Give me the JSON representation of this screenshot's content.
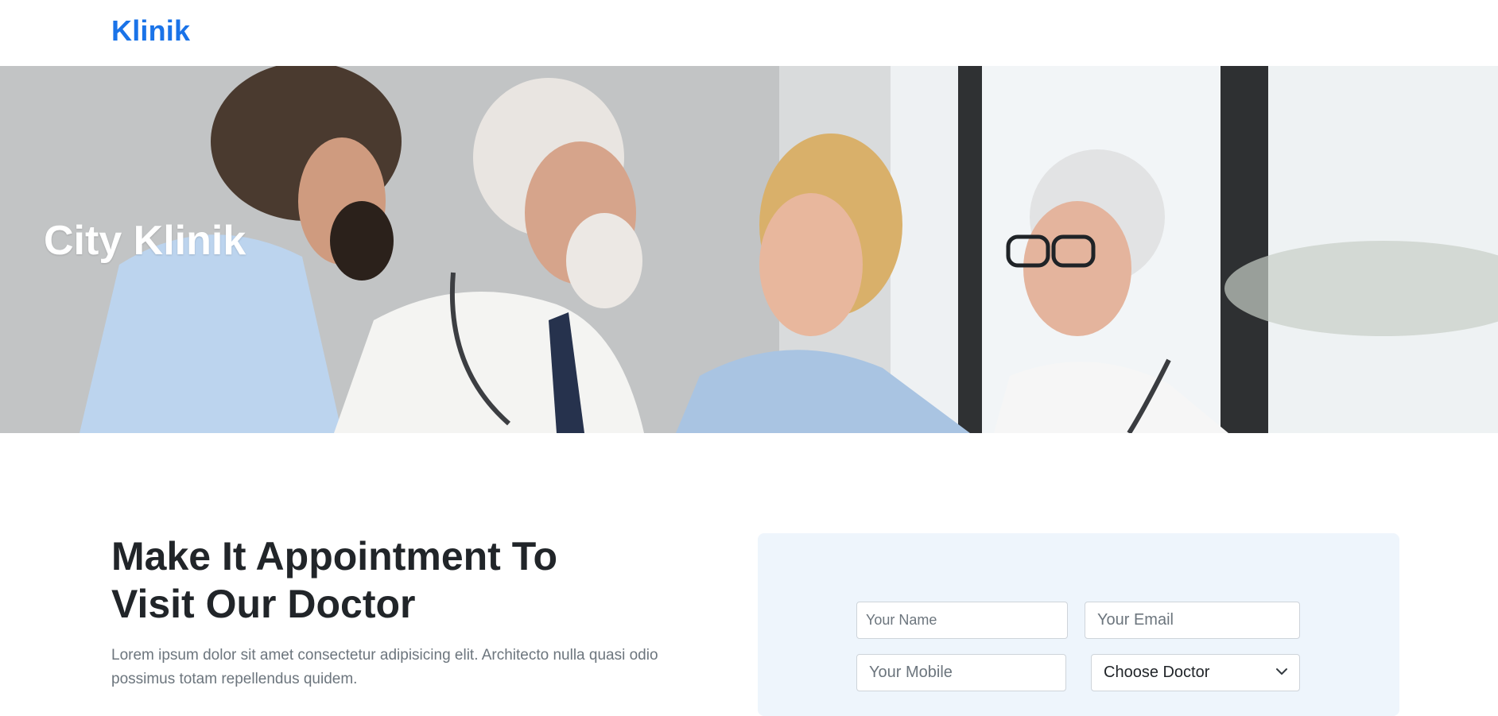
{
  "navbar": {
    "brand": "Klinik"
  },
  "hero": {
    "title": "City Klinik",
    "image_alt": "Four medical professionals talking and smiling"
  },
  "appointment": {
    "heading_line1": "Make It Appointment To",
    "heading_line2": "Visit Our Doctor",
    "text": "Lorem ipsum dolor sit amet consectetur adipisicing elit. Architecto nulla quasi odio possimus totam repellendus quidem."
  },
  "form": {
    "name_placeholder": "Your Name",
    "email_placeholder": "Your Email",
    "mobile_placeholder": "Your Mobile",
    "doctor_select": "Choose Doctor"
  },
  "colors": {
    "brand": "#1a73e8",
    "form_background": "#eef5fc",
    "muted_text": "#6c757d"
  }
}
